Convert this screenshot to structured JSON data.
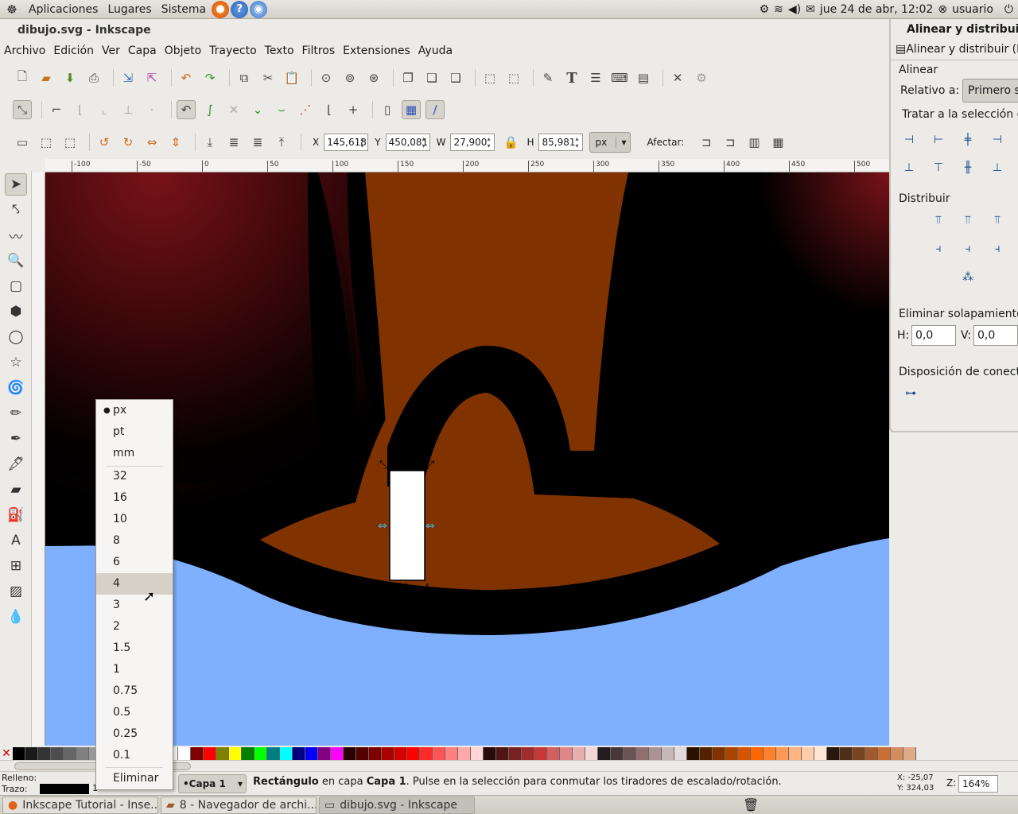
{
  "top_panel": {
    "menus": [
      "Aplicaciones",
      "Lugares",
      "Sistema"
    ],
    "clock": "jue 24 de abr, 12:02",
    "user": "usuario"
  },
  "window": {
    "title": "dibujo.svg - Inkscape"
  },
  "menubar": [
    "Archivo",
    "Edición",
    "Ver",
    "Capa",
    "Objeto",
    "Trayecto",
    "Texto",
    "Filtros",
    "Extensiones",
    "Ayuda"
  ],
  "selector_bar": {
    "x_label": "X",
    "x": "145,618",
    "y_label": "Y",
    "y": "450,081",
    "w_label": "W",
    "w": "27,900",
    "h_label": "H",
    "h": "85,981",
    "unit": "px",
    "affect_label": "Afectar:"
  },
  "ruler": {
    "h_ticks": [
      "-100",
      "-50",
      "0",
      "50",
      "100",
      "150",
      "200",
      "250",
      "300",
      "350",
      "400",
      "450",
      "500"
    ]
  },
  "unit_dropdown": {
    "items": [
      "px",
      "pt",
      "mm",
      "32",
      "16",
      "10",
      "8",
      "6",
      "4",
      "3",
      "2",
      "1.5",
      "1",
      "0.75",
      "0.5",
      "0.25",
      "0.1"
    ],
    "selected": "px",
    "highlighted": "4",
    "remove": "Eliminar"
  },
  "dock": {
    "title": "Alinear y distribuir",
    "tab": "Alinear y distribuir (M",
    "align_section": "Alinear",
    "relative_label": "Relativo a:",
    "relative_value": "Primero se",
    "treat_label": "Tratar a la selección co",
    "distribute_section": "Distribuir",
    "overlap_section": "Eliminar solapamientos",
    "h_label": "H:",
    "h_value": "0,0",
    "v_label": "V:",
    "v_value": "0,0",
    "connector_section": "Disposición de conecto"
  },
  "statusbar": {
    "fill_label": "Relleno:",
    "stroke_label": "Trazo:",
    "stroke_width": "1",
    "layer": "•Capa 1",
    "message_bold": "Rectángulo",
    "message_mid": " en capa ",
    "message_layer": "Capa 1",
    "message_rest": ". Pulse en la selección para conmutar los tiradores de escalado/rotación.",
    "cursor_x_label": "X:",
    "cursor_x": "-25,07",
    "cursor_y_label": "Y:",
    "cursor_y": "324,03",
    "zoom_label": "Z:",
    "zoom": "164%"
  },
  "taskbar": [
    "Inkscape Tutorial - Inse...",
    "8 - Navegador de archi...",
    "dibujo.svg - Inkscape"
  ],
  "palette": [
    "#000000",
    "#1a1a1a",
    "#333333",
    "#4d4d4d",
    "#666666",
    "#808080",
    "#999999",
    "#b3b3b3",
    "#cccccc",
    "#e6e6e6",
    "#f2f2f2",
    "#ffffff",
    "#ffffff",
    "#ffffff",
    "#800000",
    "#ff0000",
    "#808000",
    "#ffff00",
    "#008000",
    "#00ff00",
    "#008080",
    "#00ffff",
    "#000080",
    "#0000ff",
    "#800080",
    "#ff00ff",
    "#2b0000",
    "#550000",
    "#800000",
    "#aa0000",
    "#d40000",
    "#ff0000",
    "#ff2a2a",
    "#ff5555",
    "#ff8080",
    "#ffaaaa",
    "#ffd5d5",
    "#280b0b",
    "#501616",
    "#782121",
    "#a02c2c",
    "#c83737",
    "#d35f5f",
    "#de8787",
    "#e9afaf",
    "#f4d7d7",
    "#241c1c",
    "#483737",
    "#6c5353",
    "#916f6f",
    "#ac9393",
    "#c8b7b7",
    "#e3dbdb",
    "#2b1100",
    "#552200",
    "#803300",
    "#aa4400",
    "#d45500",
    "#ff6600",
    "#ff7f2a",
    "#ff9955",
    "#ffb380",
    "#ffccaa",
    "#ffe6d5",
    "#28170b",
    "#502d16",
    "#784421",
    "#a05a2c",
    "#c87137",
    "#d38d5f",
    "#deaa87"
  ],
  "colors": {
    "canvas_bg": "#7fb0ff",
    "brown": "#803300",
    "dark_red": "#6a1016"
  }
}
